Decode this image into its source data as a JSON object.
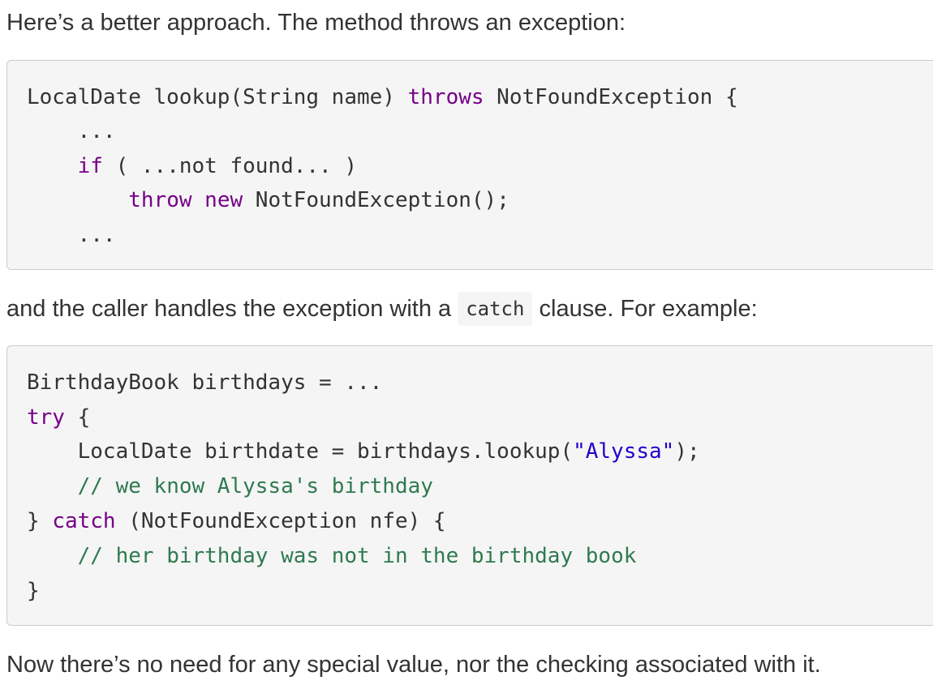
{
  "paragraphs": {
    "intro": "Here’s a better approach. The method throws an exception:",
    "middle_before": "and the caller handles the exception with a ",
    "middle_code": "catch",
    "middle_after": " clause. For example:",
    "outro": "Now there’s no need for any special value, nor the checking associated with it."
  },
  "code_block_1": {
    "lines": [
      [
        {
          "t": "LocalDate lookup(String name) ",
          "c": ""
        },
        {
          "t": "throws",
          "c": "kw"
        },
        {
          "t": " NotFoundException {",
          "c": ""
        }
      ],
      [
        {
          "t": "    ...",
          "c": ""
        }
      ],
      [
        {
          "t": "    ",
          "c": ""
        },
        {
          "t": "if",
          "c": "kw"
        },
        {
          "t": " ( ...not found... )",
          "c": ""
        }
      ],
      [
        {
          "t": "        ",
          "c": ""
        },
        {
          "t": "throw",
          "c": "kw"
        },
        {
          "t": " ",
          "c": ""
        },
        {
          "t": "new",
          "c": "kw"
        },
        {
          "t": " NotFoundException();",
          "c": ""
        }
      ],
      [
        {
          "t": "    ...",
          "c": ""
        }
      ]
    ]
  },
  "code_block_2": {
    "lines": [
      [
        {
          "t": "BirthdayBook birthdays = ...",
          "c": ""
        }
      ],
      [
        {
          "t": "try",
          "c": "kw"
        },
        {
          "t": " {",
          "c": ""
        }
      ],
      [
        {
          "t": "    LocalDate birthdate = birthdays.lookup(",
          "c": ""
        },
        {
          "t": "\"Alyssa\"",
          "c": "str"
        },
        {
          "t": ");",
          "c": ""
        }
      ],
      [
        {
          "t": "    ",
          "c": ""
        },
        {
          "t": "// we know Alyssa's birthday",
          "c": "cmt"
        }
      ],
      [
        {
          "t": "} ",
          "c": ""
        },
        {
          "t": "catch",
          "c": "kw"
        },
        {
          "t": " (NotFoundException nfe) {",
          "c": ""
        }
      ],
      [
        {
          "t": "    ",
          "c": ""
        },
        {
          "t": "// her birthday was not in the birthday book",
          "c": "cmt"
        }
      ],
      [
        {
          "t": "}",
          "c": ""
        }
      ]
    ]
  }
}
